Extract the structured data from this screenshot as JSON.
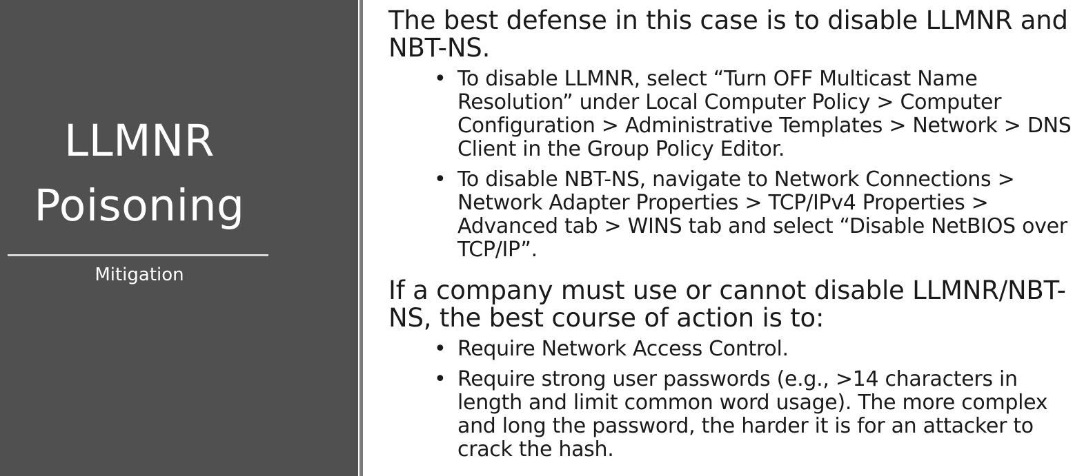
{
  "sidebar": {
    "title_line1": "LLMNR",
    "title_line2": "Poisoning",
    "subtitle": "Mitigation"
  },
  "main": {
    "paragraph1": "The best defense in this case is to disable LLMNR and NBT-NS.",
    "bullets1": [
      "To disable LLMNR, select “Turn OFF Multicast Name Resolution” under Local Computer Policy > Computer Configuration > Administrative Templates > Network > DNS Client in the Group Policy Editor.",
      "To disable NBT-NS, navigate to Network Connections > Network Adapter Properties > TCP/IPv4 Properties > Advanced tab > WINS tab and select “Disable NetBIOS over TCP/IP”."
    ],
    "paragraph2": "If a company must use or cannot disable LLMNR/NBT-NS, the best course of action is to:",
    "bullets2": [
      "Require Network Access Control.",
      "Require strong user passwords (e.g., >14 characters in length and limit common word usage).  The more complex and long the password, the harder it is for an attacker to crack the hash."
    ],
    "bullet_glyph": "•"
  },
  "colors": {
    "sidebar_bg": "#505050",
    "sidebar_text": "#ffffff",
    "body_text": "#1a1a1a",
    "background": "#ffffff"
  }
}
